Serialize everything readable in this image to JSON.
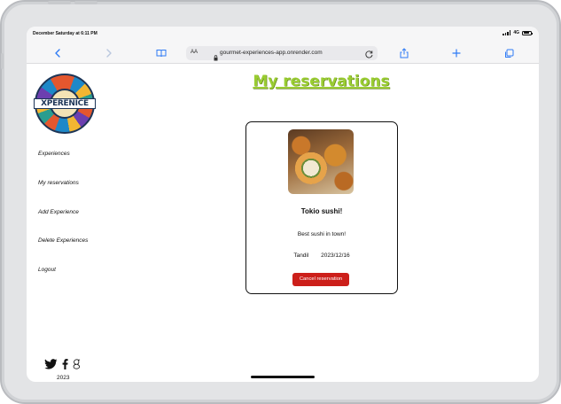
{
  "status_bar": {
    "time": "December Saturday at 6:11 PM",
    "network": "4G"
  },
  "browser": {
    "text_size_label": "AA",
    "url": "gourmet-experiences-app.onrender.com"
  },
  "sidebar": {
    "logo_text": "XPERENICE",
    "items": [
      {
        "label": "Experiences"
      },
      {
        "label": "My reservations"
      },
      {
        "label": "Add Experience"
      },
      {
        "label": "Delete Experiences"
      },
      {
        "label": "Logout"
      }
    ],
    "social_icons": [
      "twitter-icon",
      "facebook-icon",
      "google-icon"
    ],
    "footer_year": "2023"
  },
  "main": {
    "title": "My reservations",
    "title_color": "#9acd32",
    "reservation": {
      "name": "Tokio sushi!",
      "description": "Best sushi in town!",
      "city": "Tandil",
      "date": "2023/12/16",
      "cancel_label": "Cancel reservation",
      "cancel_color": "#cc1f1a"
    }
  }
}
